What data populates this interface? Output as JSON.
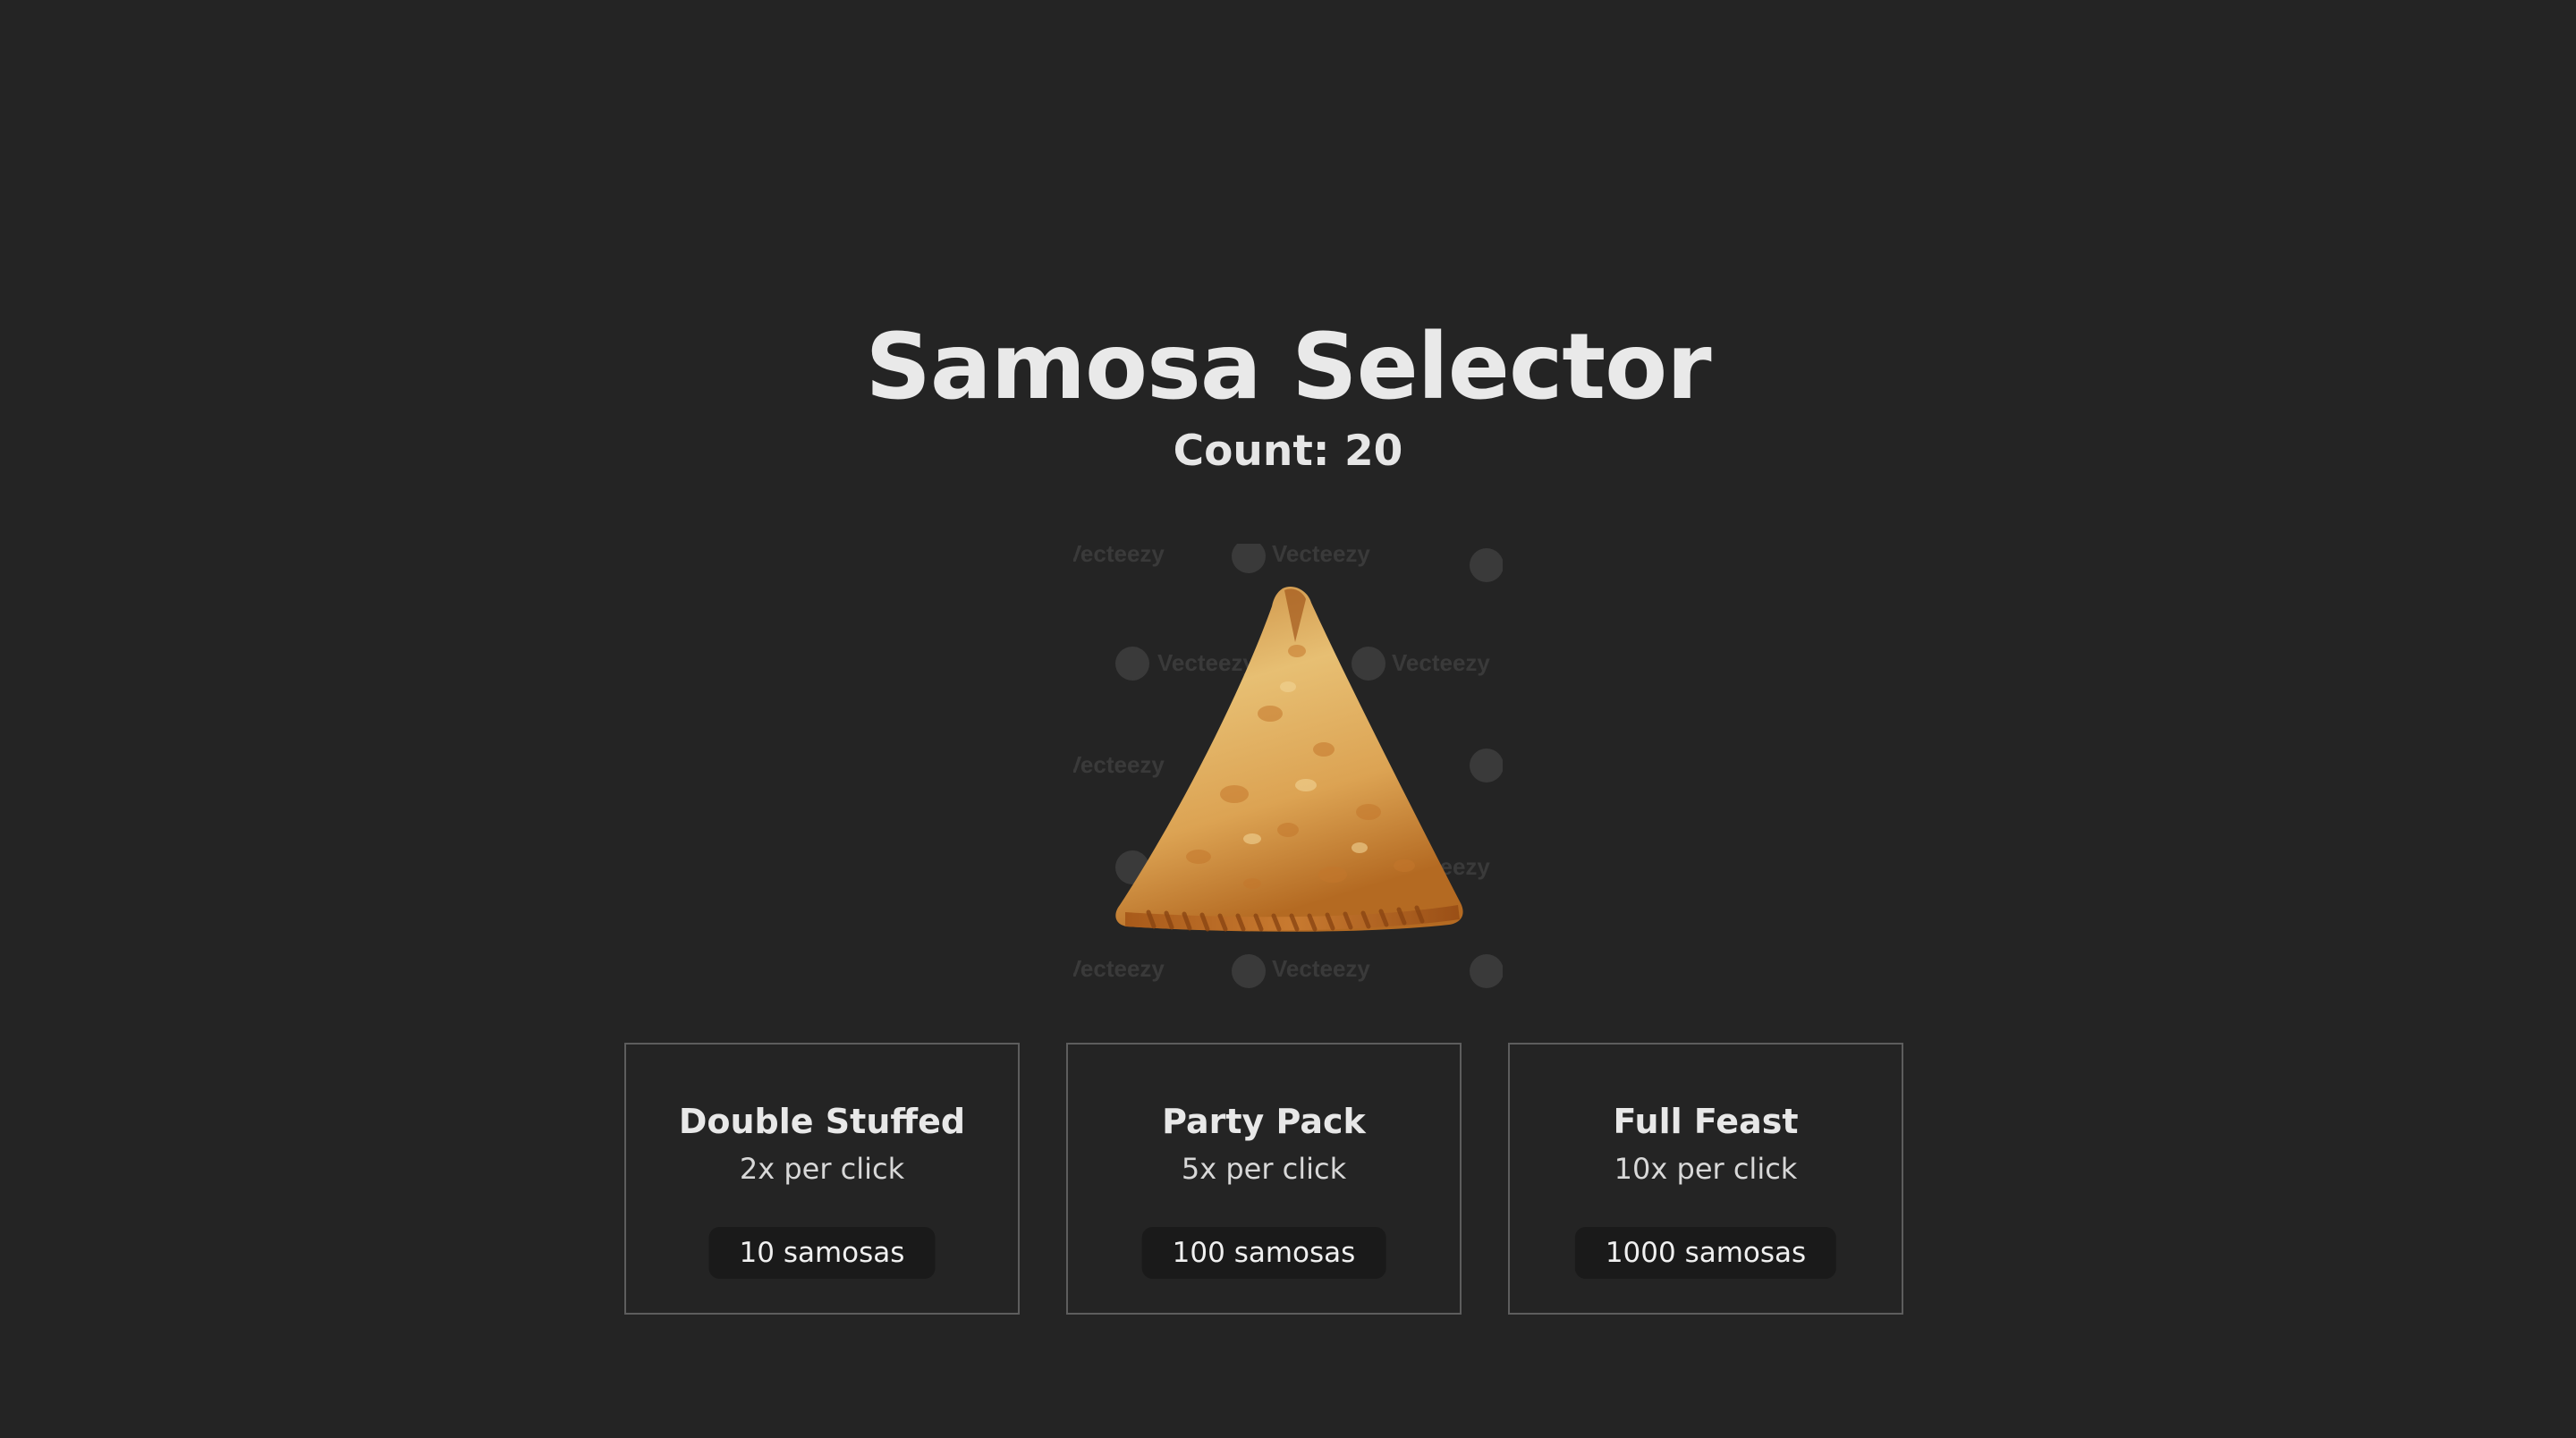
{
  "app": {
    "title": "Samosa Selector",
    "count_label": "Count: 20",
    "count_value": 20
  },
  "samosa_image": {
    "icon": "samosa-image",
    "watermark_text": "Vecteezy"
  },
  "upgrades": [
    {
      "name": "Double Stuffed",
      "rate": "2x per click",
      "cost": "10 samosas"
    },
    {
      "name": "Party Pack",
      "rate": "5x per click",
      "cost": "100 samosas"
    },
    {
      "name": "Full Feast",
      "rate": "10x per click",
      "cost": "1000 samosas"
    }
  ],
  "colors": {
    "background": "#242424",
    "text": "#e3e3e3",
    "card_border": "#5d5d5d",
    "button_bg": "#1a1a1a"
  }
}
